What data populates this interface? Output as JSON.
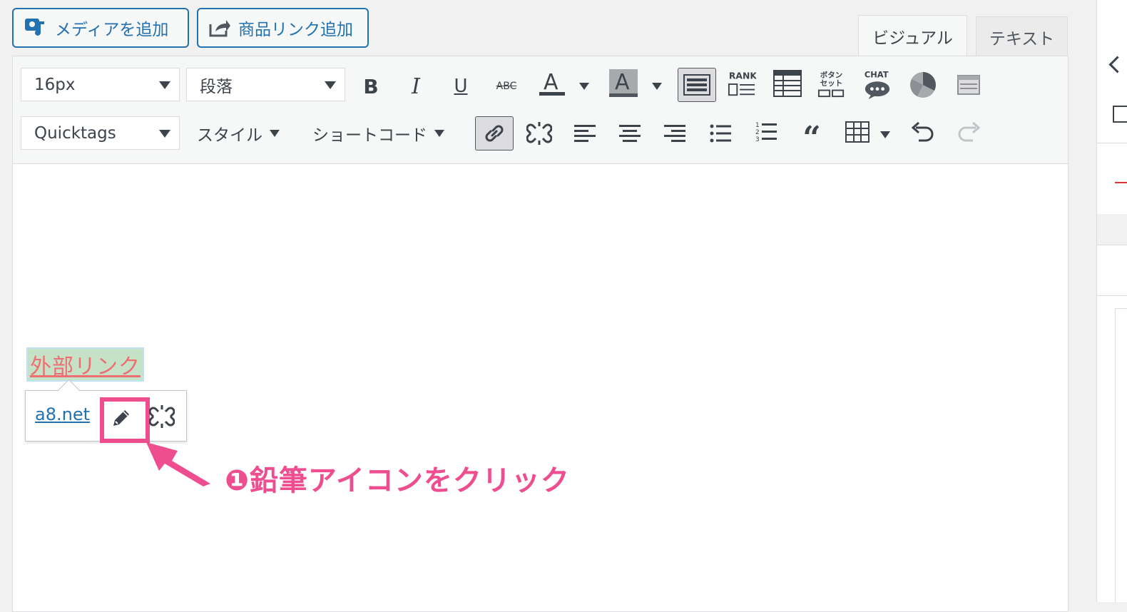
{
  "media_buttons": {
    "add_media": "メディアを追加",
    "add_product_link": "商品リンク追加"
  },
  "tabs": {
    "visual": "ビジュアル",
    "text": "テキスト"
  },
  "toolbar": {
    "font_size": "16px",
    "format": "段落",
    "quicktags": "Quicktags",
    "style_menu": "スタイル",
    "shortcode_menu": "ショートコード",
    "rank_label": "RANK",
    "button_set_label_1": "ボタン",
    "button_set_label_2": "セット",
    "chat_label": "CHAT",
    "abc_label": "ABC"
  },
  "content": {
    "link_text": "外部リンク"
  },
  "link_popup": {
    "url": "a8.net"
  },
  "annotation": {
    "text": "❶鉛筆アイコンをクリック"
  },
  "colors": {
    "accent": "#2271b1",
    "annotation": "#ee4d8f",
    "link_text": "#ee6e73"
  }
}
